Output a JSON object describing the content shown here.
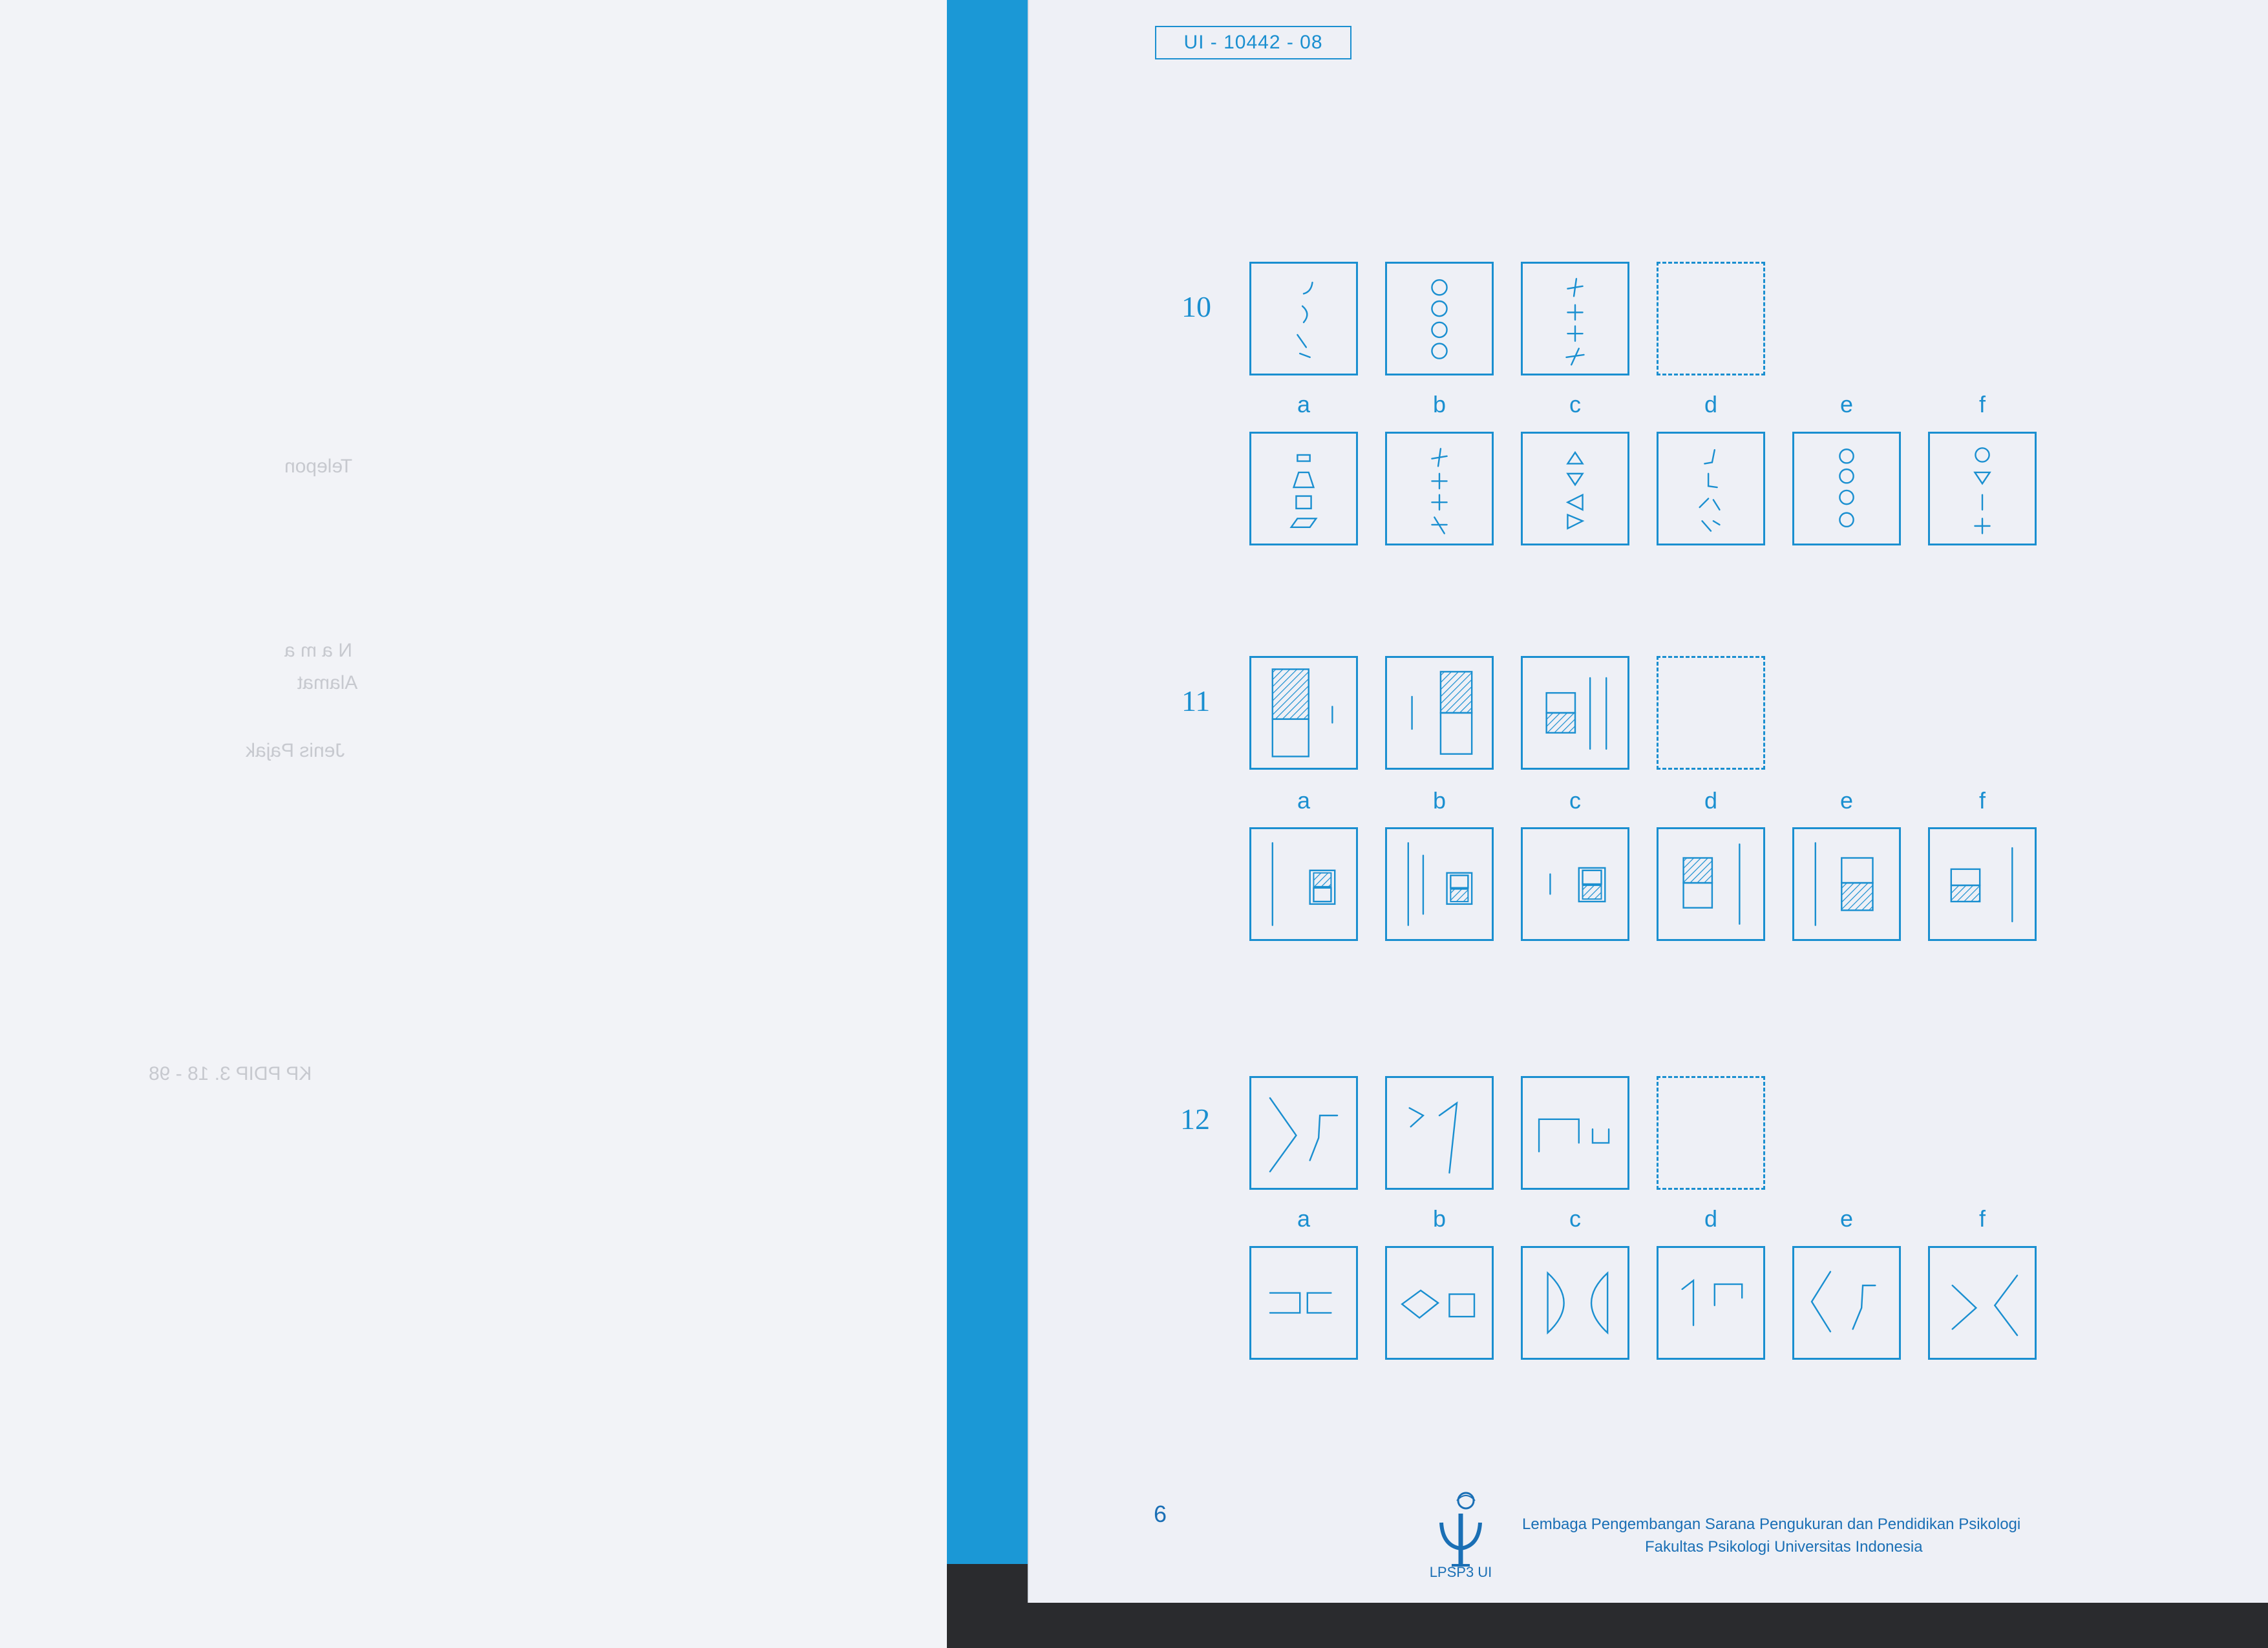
{
  "document": {
    "code": "UI - 10442 - 08",
    "page_number": "6",
    "footer_line1": "Lembaga Pengembangan Sarana Pengukuran dan Pendidikan Psikologi",
    "footer_line2": "Fakultas Psikologi Universitas Indonesia",
    "logo_caption": "LPSP3 UI"
  },
  "left_page_ghost_text": {
    "phone": "Telepon",
    "name": "N a m a",
    "address": "Alamat",
    "tax": "Jenis Pajak",
    "form_code": "KP PDIP 3. 18 - 98"
  },
  "questions": [
    {
      "number": "10",
      "options": [
        "a",
        "b",
        "c",
        "d",
        "e",
        "f"
      ]
    },
    {
      "number": "11",
      "options": [
        "a",
        "b",
        "c",
        "d",
        "e",
        "f"
      ]
    },
    {
      "number": "12",
      "options": [
        "a",
        "b",
        "c",
        "d",
        "e",
        "f"
      ]
    }
  ],
  "colors": {
    "ink": "#1a8fd0",
    "binding": "#1b98d6",
    "paper": "#eef0f6"
  }
}
